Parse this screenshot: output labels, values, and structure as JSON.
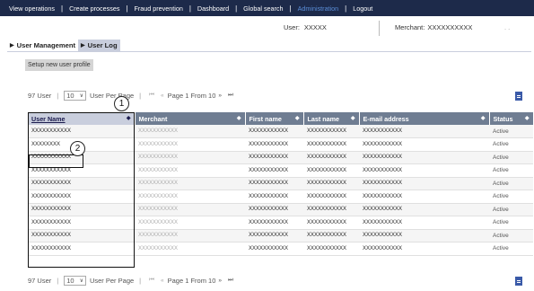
{
  "nav": {
    "items": [
      "View operations",
      "Create processes",
      "Fraud prevention",
      "Dashboard",
      "Global search",
      "Administration",
      "Logout"
    ],
    "active_index": 5,
    "active_color": "#5b8ed8"
  },
  "header": {
    "user_label": "User:",
    "user_value": "XXXXX",
    "merchant_label": "Merchant:",
    "merchant_value": "XXXXXXXXXX",
    "ellipsis": ". ."
  },
  "tabs": [
    "User Management",
    "User Log"
  ],
  "setup_button": "Setup new user profile",
  "pager": {
    "count_text": "97 User",
    "page_size": "10",
    "per_page_label": "User Per Page",
    "first": "⏮",
    "prev": "«",
    "page_text": "Page 1 From 10",
    "next": "»",
    "last": "⏭"
  },
  "table": {
    "columns": [
      "User Name",
      "Merchant",
      "First name",
      "Last name",
      "E-mail address",
      "Status"
    ],
    "rows": [
      [
        "XXXXXXXXXXX",
        "XXXXXXXXXXX",
        "XXXXXXXXXXX",
        "XXXXXXXXXXX",
        "XXXXXXXXXXX",
        "Active"
      ],
      [
        "XXXXXXXX",
        "XXXXXXXXXXX",
        "XXXXXXXXXXX",
        "XXXXXXXXXXX",
        "XXXXXXXXXXX",
        "Active"
      ],
      [
        "XXXXXXXXXXX",
        "XXXXXXXXXXX",
        "XXXXXXXXXXX",
        "XXXXXXXXXXX",
        "XXXXXXXXXXX",
        "Active"
      ],
      [
        "XXXXXXXXXXX",
        "XXXXXXXXXXX",
        "XXXXXXXXXXX",
        "XXXXXXXXXXX",
        "XXXXXXXXXXX",
        "Active"
      ],
      [
        "XXXXXXXXXXX",
        "XXXXXXXXXXX",
        "XXXXXXXXXXX",
        "XXXXXXXXXXX",
        "XXXXXXXXXXX",
        "Active"
      ],
      [
        "XXXXXXXXXXX",
        "XXXXXXXXXXX",
        "XXXXXXXXXXX",
        "XXXXXXXXXXX",
        "XXXXXXXXXXX",
        "Active"
      ],
      [
        "XXXXXXXXXXX",
        "XXXXXXXXXXX",
        "XXXXXXXXXXX",
        "XXXXXXXXXXX",
        "XXXXXXXXXXX",
        "Active"
      ],
      [
        "XXXXXXXXXXX",
        "XXXXXXXXXXX",
        "XXXXXXXXXXX",
        "XXXXXXXXXXX",
        "XXXXXXXXXXX",
        "Active"
      ],
      [
        "XXXXXXXXXXX",
        "XXXXXXXXXXX",
        "XXXXXXXXXXX",
        "XXXXXXXXXXX",
        "XXXXXXXXXXX",
        "Active"
      ],
      [
        "XXXXXXXXXXX",
        "XXXXXXXXXXX",
        "XXXXXXXXXXX",
        "XXXXXXXXXXX",
        "XXXXXXXXXXX",
        "Active"
      ]
    ]
  },
  "callouts": [
    "1",
    "2"
  ],
  "icons": {
    "tab_arrow": "▶",
    "sort": "◆",
    "dropdown": "∨",
    "document": "document-icon"
  },
  "colors": {
    "topnav_bg": "#1d2a4a",
    "header_bg": "#6f7d92",
    "selected_tab_bg": "#c9cedd",
    "doc_icon": "#3a5aa8"
  }
}
